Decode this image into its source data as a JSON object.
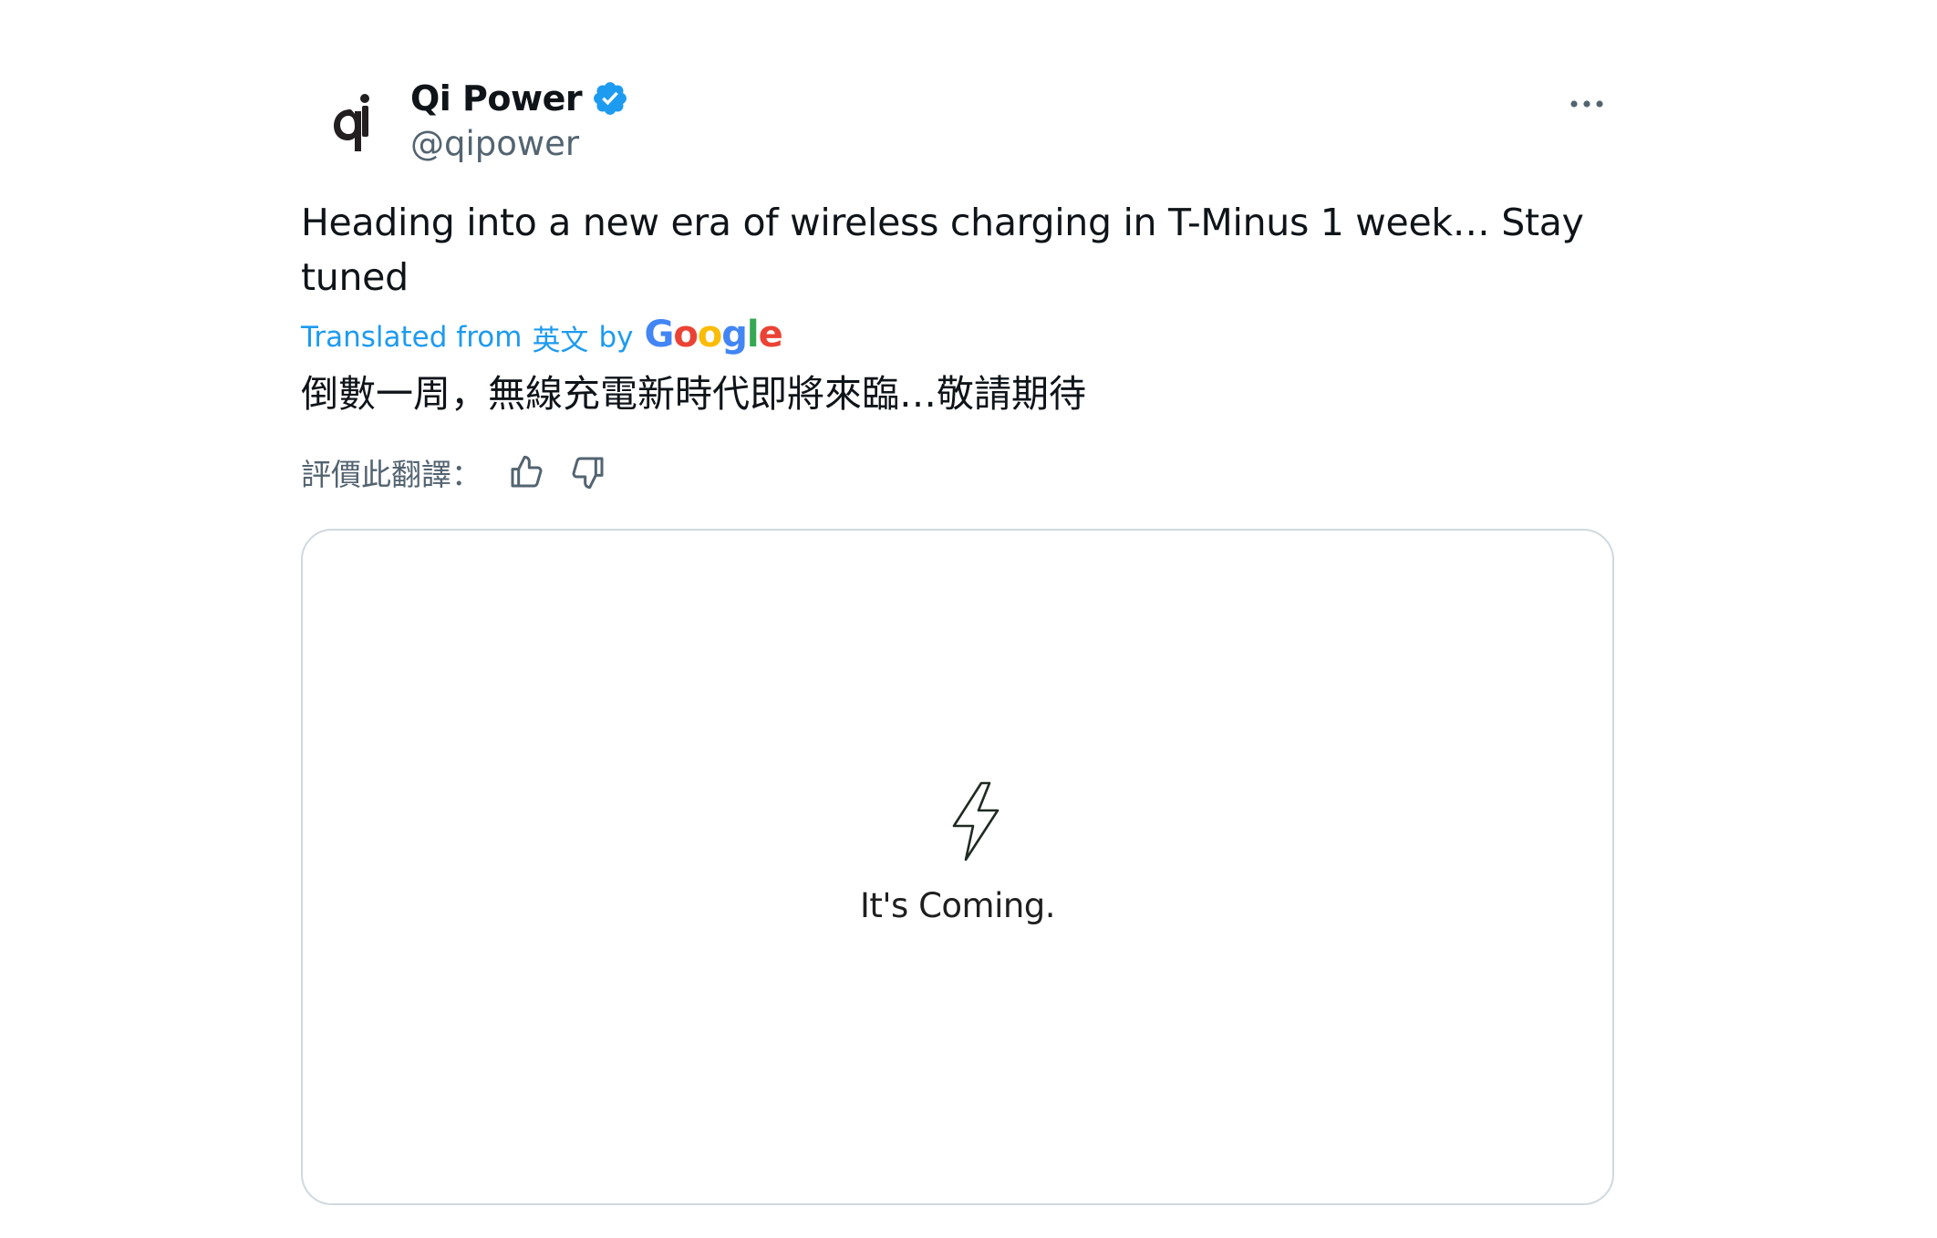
{
  "author": {
    "display_name": "Qi Power",
    "handle": "@qipower",
    "verified": true,
    "avatar_icon": "qi-logo",
    "verified_color": "#1d9bf0"
  },
  "tweet": {
    "text": "Heading into a new era of wireless charging in T-Minus 1 week… Stay tuned"
  },
  "translation": {
    "prefix": "Translated from",
    "language": "英文",
    "by": "by",
    "provider": "Google",
    "text": "倒數一周，無線充電新時代即將來臨…敬請期待",
    "rate_label": "評價此翻譯：",
    "link_color": "#1d9bf0"
  },
  "media": {
    "caption": "It's Coming.",
    "icon": "lightning-bolt-icon"
  },
  "icons": {
    "more": "more-horizontal-icon",
    "thumbs_up": "thumbs-up-icon",
    "thumbs_down": "thumbs-down-icon"
  }
}
